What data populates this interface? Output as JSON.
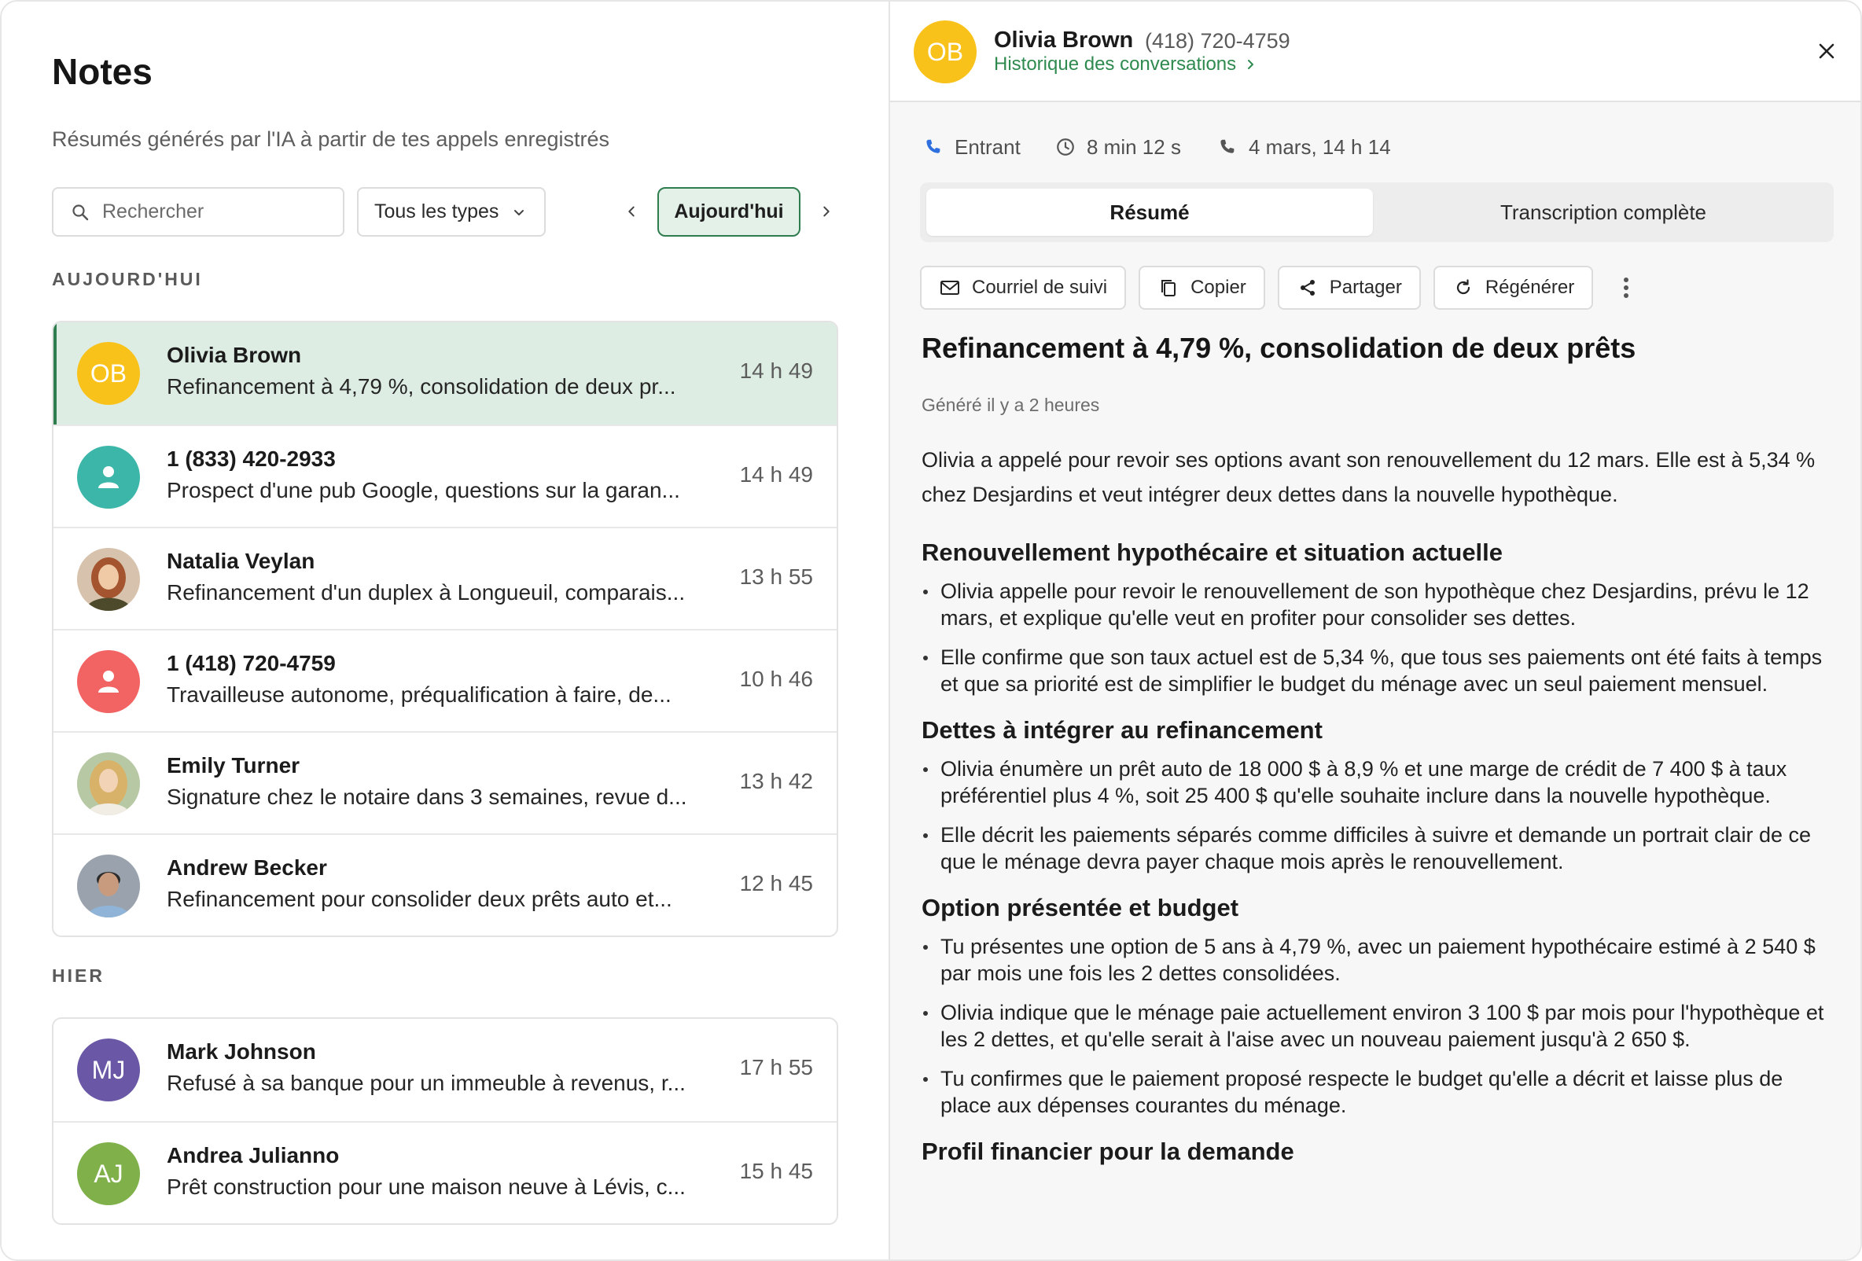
{
  "notes": {
    "title": "Notes",
    "subtitle": "Résumés générés par l'IA à partir de tes appels enregistrés",
    "search_placeholder": "Rechercher",
    "type_filter": "Tous les types",
    "date_button": "Aujourd'hui",
    "sections": [
      {
        "label": "AUJOURD'HUI",
        "items": [
          {
            "initials": "OB",
            "avatar_color": "#f8c21a",
            "name": "Olivia Brown",
            "desc": "Refinancement à 4,79 %, consolidation de deux pr...",
            "time": "14 h 49",
            "selected": true
          },
          {
            "initials": "",
            "avatar_color": "#3cb6a9",
            "avatar_icon": "person-icon",
            "name": "1 (833) 420-2933",
            "desc": "Prospect d'une pub Google, questions sur la garan...",
            "time": "14 h 49"
          },
          {
            "initials": "",
            "avatar_color": "#b88a6a",
            "avatar_icon": "photo",
            "name": "Natalia Veylan",
            "desc": "Refinancement d'un duplex à Longueuil, comparais...",
            "time": "13 h 55"
          },
          {
            "initials": "",
            "avatar_color": "#f26363",
            "avatar_icon": "person-icon",
            "name": "1 (418) 720-4759",
            "desc": "Travailleuse autonome, préqualification à faire, de...",
            "time": "10 h 46"
          },
          {
            "initials": "",
            "avatar_color": "#c9a46a",
            "avatar_icon": "photo",
            "name": "Emily Turner",
            "desc": "Signature chez le notaire dans 3 semaines, revue d...",
            "time": "13 h 42"
          },
          {
            "initials": "",
            "avatar_color": "#6b7280",
            "avatar_icon": "photo",
            "name": "Andrew Becker",
            "desc": "Refinancement pour consolider deux prêts auto et...",
            "time": "12 h 45"
          }
        ]
      },
      {
        "label": "HIER",
        "items": [
          {
            "initials": "MJ",
            "avatar_color": "#6a58a6",
            "name": "Mark Johnson",
            "desc": "Refusé à sa banque pour un immeuble à revenus, r...",
            "time": "17 h 55"
          },
          {
            "initials": "AJ",
            "avatar_color": "#7fb04a",
            "name": "Andrea Julianno",
            "desc": "Prêt construction pour une maison neuve à Lévis, c...",
            "time": "15 h 45"
          }
        ]
      }
    ]
  },
  "detail": {
    "initials": "OB",
    "name": "Olivia Brown",
    "phone": "(418) 720-4759",
    "history_link": "Historique des conversations",
    "direction": "Entrant",
    "duration": "8 min 12 s",
    "datetime": "4 mars, 14 h 14",
    "tabs": [
      "Résumé",
      "Transcription complète"
    ],
    "actions": [
      "Courriel de suivi",
      "Copier",
      "Partager",
      "Régénérer"
    ],
    "summary_title": "Refinancement à 4,79 %, consolidation de deux prêts",
    "generated": "Généré il y a 2 heures",
    "intro": "Olivia a appelé pour revoir ses options avant son renouvellement du 12 mars. Elle est à 5,34 % chez Desjardins et veut intégrer deux dettes dans la nouvelle hypothèque.",
    "sections": [
      {
        "heading": "Renouvellement hypothécaire et situation actuelle",
        "bullets": [
          "Olivia appelle pour revoir le renouvellement de son hypothèque chez Desjardins, prévu le 12 mars, et explique qu'elle veut en profiter pour consolider ses dettes.",
          "Elle confirme que son taux actuel est de 5,34 %, que tous ses paiements ont été faits à temps et que sa priorité est de simplifier le budget du ménage avec un seul paiement mensuel."
        ]
      },
      {
        "heading": "Dettes à intégrer au refinancement",
        "bullets": [
          "Olivia énumère un prêt auto de 18 000 $ à 8,9 % et une marge de crédit de 7 400 $ à taux préférentiel plus 4 %, soit 25 400 $ qu'elle souhaite inclure dans la nouvelle hypothèque.",
          "Elle décrit les paiements séparés comme difficiles à suivre et demande un portrait clair de ce que le ménage devra payer chaque mois après le renouvellement."
        ]
      },
      {
        "heading": "Option présentée et budget",
        "bullets": [
          "Tu présentes une option de 5 ans à 4,79 %, avec un paiement hypothécaire estimé à 2 540 $ par mois une fois les 2 dettes consolidées.",
          "Olivia indique que le ménage paie actuellement environ 3 100 $ par mois pour l'hypothèque et les 2 dettes, et qu'elle serait à l'aise avec un nouveau paiement jusqu'à 2 650 $.",
          "Tu confirmes que le paiement proposé respecte le budget qu'elle a décrit et laisse plus de place aux dépenses courantes du ménage."
        ]
      },
      {
        "heading": "Profil financier pour la demande",
        "bullets": []
      }
    ]
  },
  "colors": {
    "accent_green": "#2e7d4f",
    "selected_row": "#deede3",
    "link_green": "#2e8a4e",
    "phone_blue": "#2f6fde"
  }
}
